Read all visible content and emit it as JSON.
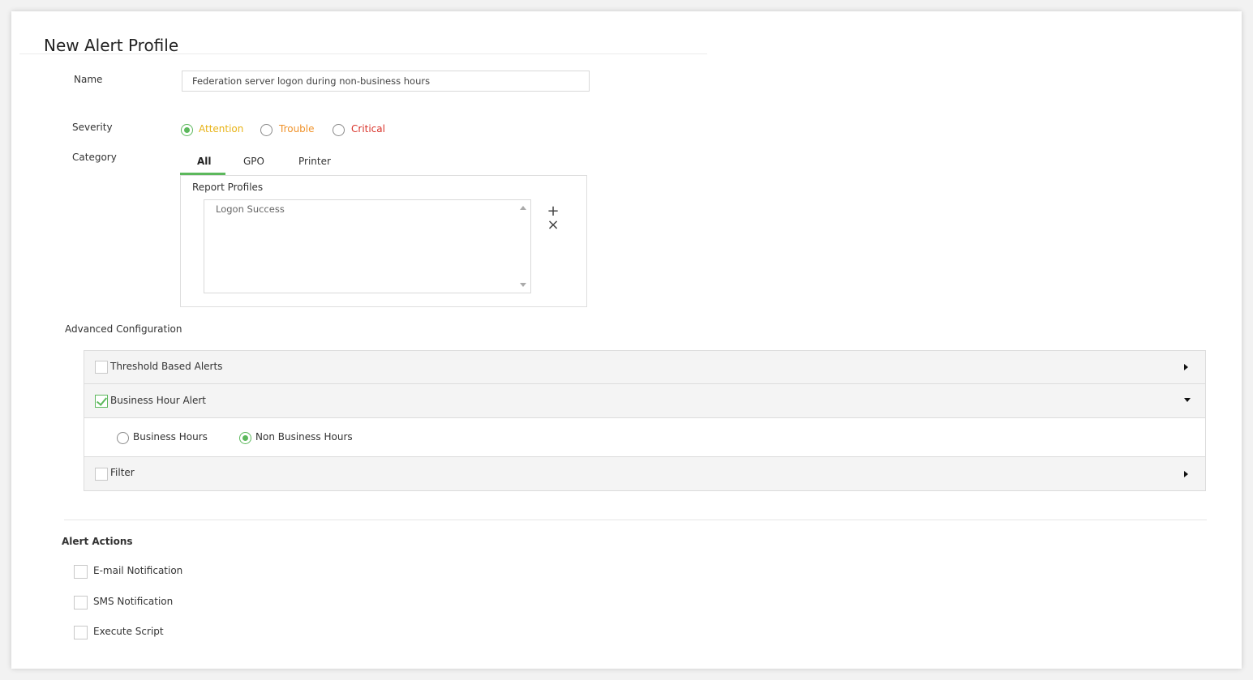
{
  "page": {
    "title": "New Alert Profile"
  },
  "name_field": {
    "label": "Name",
    "value": "Federation server logon during non-business hours"
  },
  "severity": {
    "label": "Severity",
    "options": [
      {
        "label": "Attention",
        "color": "#e8b317",
        "selected": true
      },
      {
        "label": "Trouble",
        "color": "#f0932b",
        "selected": false
      },
      {
        "label": "Critical",
        "color": "#d9342b",
        "selected": false
      }
    ]
  },
  "category": {
    "label": "Category",
    "tabs": [
      {
        "label": "All",
        "active": true
      },
      {
        "label": "GPO",
        "active": false
      },
      {
        "label": "Printer",
        "active": false
      }
    ],
    "report_profiles_label": "Report Profiles",
    "report_profiles": [
      "Logon Success"
    ],
    "add_symbol": "+",
    "remove_symbol": "×"
  },
  "advanced": {
    "label": "Advanced Configuration",
    "sections": [
      {
        "label": "Threshold Based Alerts",
        "checked": false,
        "expanded": false
      },
      {
        "label": "Business Hour Alert",
        "checked": true,
        "expanded": true
      },
      {
        "label": "Filter",
        "checked": false,
        "expanded": false
      }
    ],
    "business_hour_options": [
      {
        "label": "Business Hours",
        "selected": false
      },
      {
        "label": "Non Business Hours",
        "selected": true
      }
    ]
  },
  "alert_actions": {
    "label": "Alert Actions",
    "items": [
      {
        "label": "E-mail Notification",
        "checked": false
      },
      {
        "label": "SMS Notification",
        "checked": false
      },
      {
        "label": "Execute Script",
        "checked": false
      }
    ]
  },
  "colors": {
    "accent": "#5cb85c"
  }
}
